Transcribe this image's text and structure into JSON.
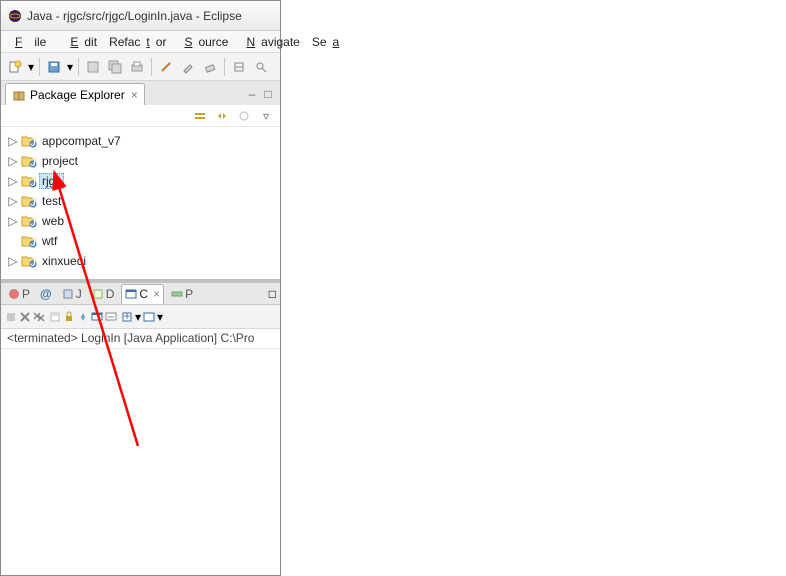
{
  "window": {
    "title": "Java - rjgc/src/rjgc/LoginIn.java - Eclipse"
  },
  "menu": {
    "file": "File",
    "edit": "Edit",
    "refactor": "Refactor",
    "source": "Source",
    "navigate": "Navigate",
    "search": "Sea"
  },
  "packageExplorer": {
    "tabLabel": "Package Explorer",
    "projects": [
      {
        "name": "appcompat_v7",
        "expandable": true
      },
      {
        "name": "project",
        "expandable": true
      },
      {
        "name": "rjgc",
        "expandable": true,
        "selected": true
      },
      {
        "name": "test",
        "expandable": true
      },
      {
        "name": "web",
        "expandable": true
      },
      {
        "name": "wtf",
        "expandable": false
      },
      {
        "name": "xinxueqi",
        "expandable": true
      }
    ]
  },
  "bottomPanel": {
    "tabs": {
      "problems": "P",
      "javadoc": "@",
      "declaration": "J",
      "declaration2": "D",
      "console": "C",
      "progress": "P"
    },
    "activeTab": "console",
    "status": "<terminated> LoginIn [Java Application] C:\\Pro"
  },
  "icons": {
    "eclipse": "eclipse-icon",
    "package": "package-icon",
    "close": "×",
    "min": "–",
    "max": "□",
    "dropdown": "▾",
    "triangle": "▷",
    "console": "console-icon"
  },
  "colors": {
    "selection": "#cde6f7",
    "arrow": "#ff0000"
  }
}
